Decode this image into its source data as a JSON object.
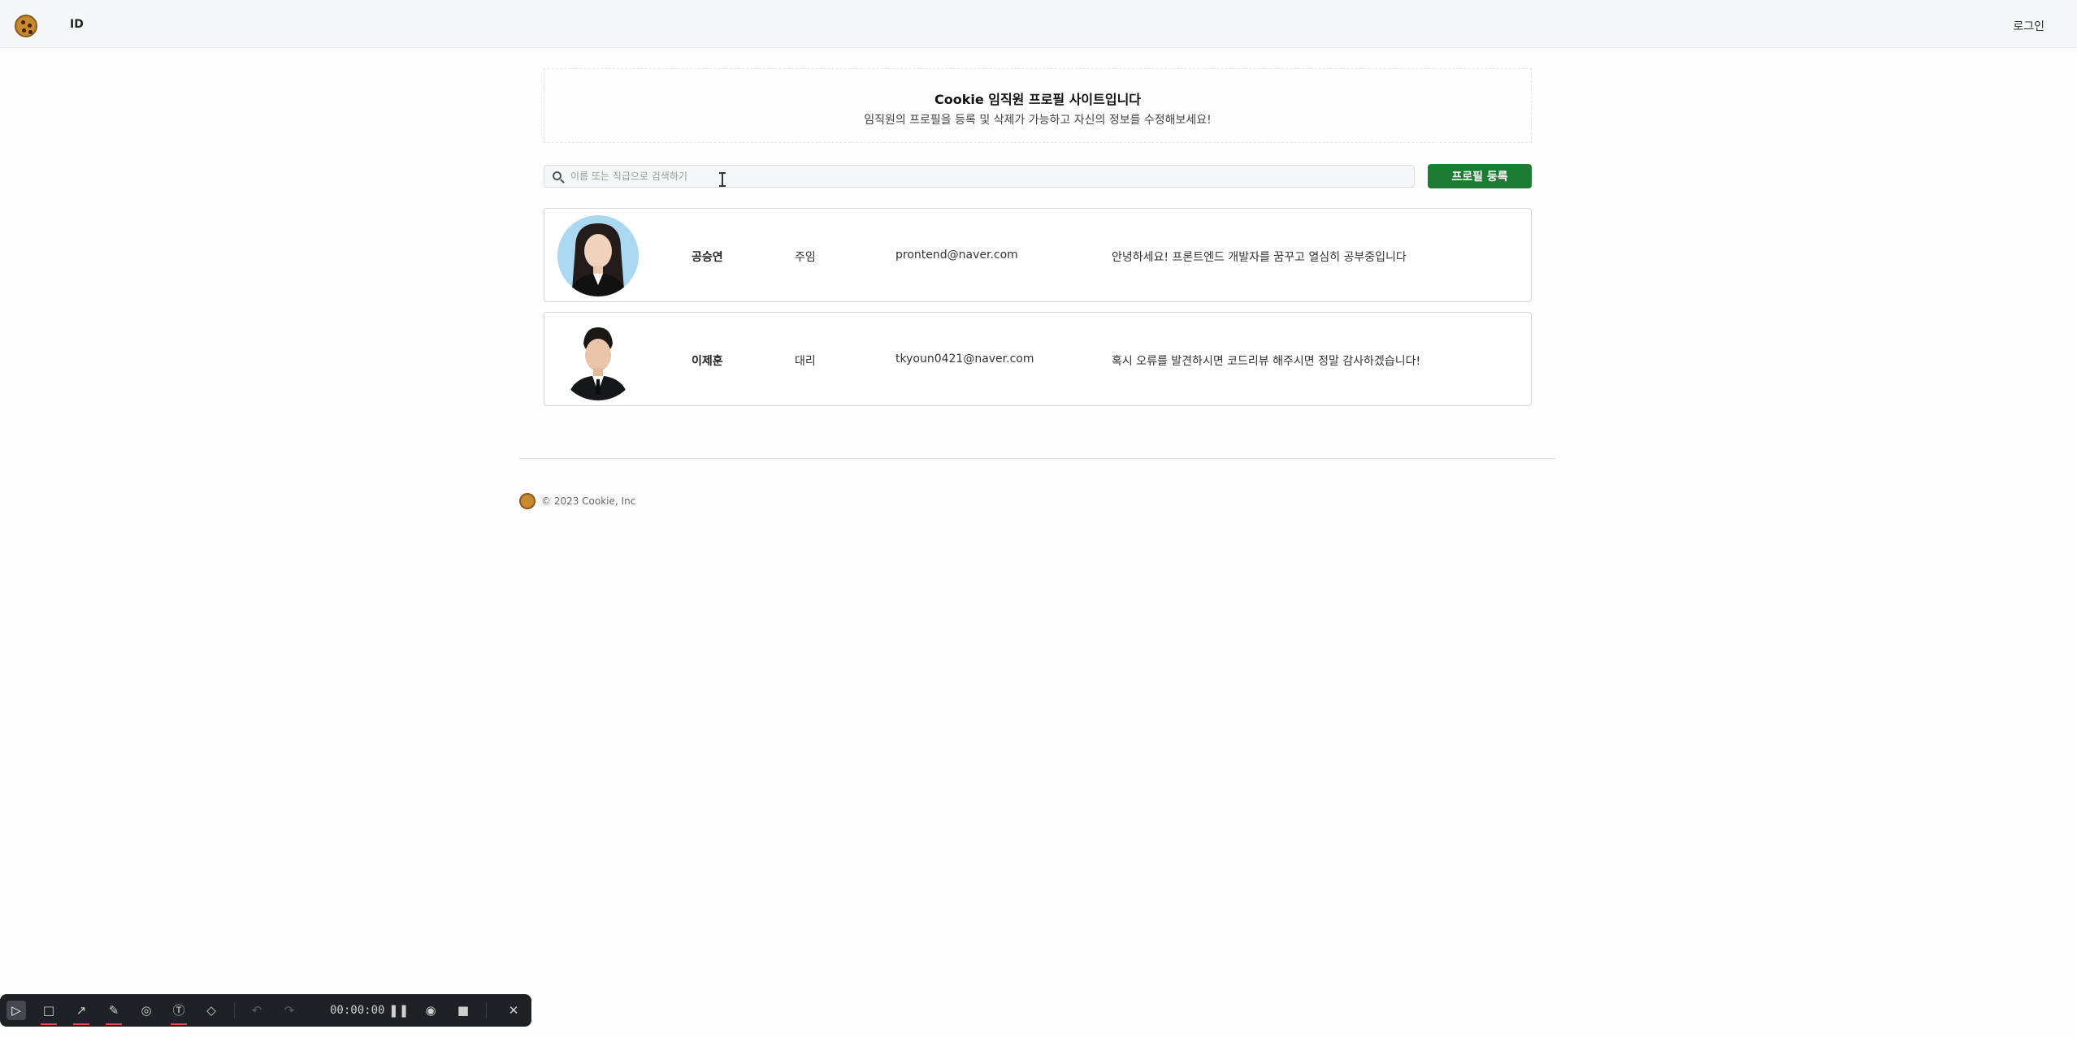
{
  "header": {
    "nav_id": "ID",
    "login_label": "로그인"
  },
  "hero": {
    "title": "Cookie 임직원 프로필 사이트입니다",
    "subtitle": "임직원의 프로필을 등록 및 삭제가 가능하고 자신의 정보를 수정해보세요!"
  },
  "search": {
    "placeholder": "이름 또는 직급으로 검색하기",
    "value": ""
  },
  "register_button_label": "프로필 등록",
  "profiles": [
    {
      "name": "공승연",
      "rank": "주임",
      "email": "prontend@naver.com",
      "intro": "안녕하세요! 프론트엔드 개발자를 꿈꾸고 열심히 공부중입니다"
    },
    {
      "name": "이제훈",
      "rank": "대리",
      "email": "tkyoun0421@naver.com",
      "intro": "혹시 오류를 발견하시면 코드리뷰 해주시면 정말 감사하겠습니다!"
    }
  ],
  "footer": {
    "copyright": "© 2023 Cookie, Inc"
  },
  "recorder": {
    "time": "00:00:00",
    "tools": [
      "select-icon",
      "rectangle-icon",
      "arrow-icon",
      "pen-icon",
      "highlighter-icon",
      "text-icon",
      "eraser-icon",
      "undo-icon",
      "redo-icon",
      "pause-icon",
      "record-icon",
      "stop-icon",
      "close-icon"
    ]
  },
  "colors": {
    "accent_green": "#1e7b34",
    "recorder_bg": "#1f2124",
    "recorder_marker": "#e14b4b"
  }
}
